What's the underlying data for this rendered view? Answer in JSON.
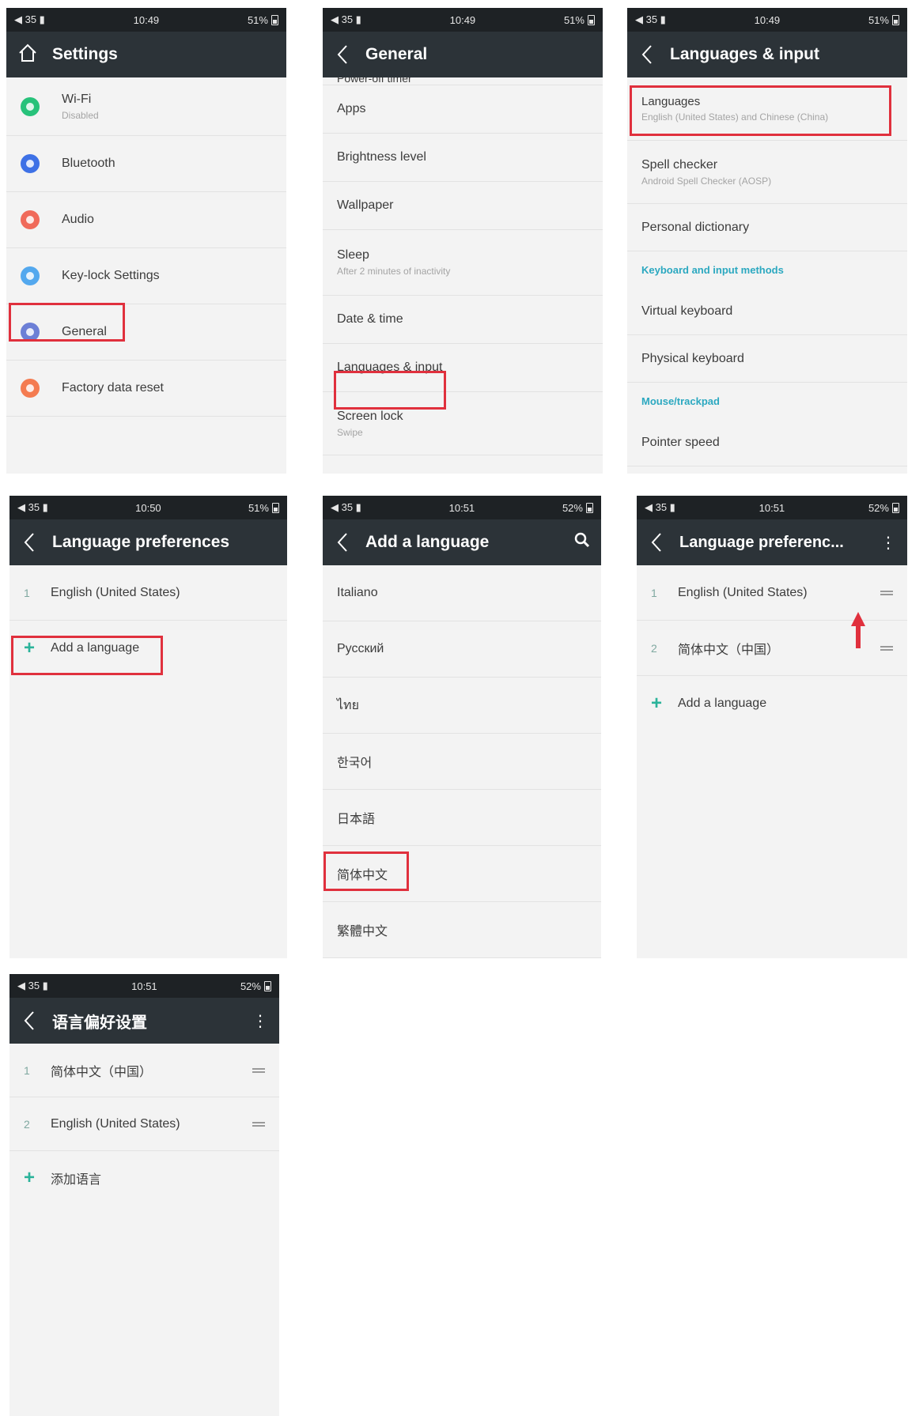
{
  "status": {
    "s1": {
      "left": "◀ 35 ▮",
      "time": "10:49",
      "battery": "51%"
    },
    "s2": {
      "left": "◀ 35 ▮",
      "time": "10:49",
      "battery": "51%"
    },
    "s3": {
      "left": "◀ 35 ▮",
      "time": "10:49",
      "battery": "51%"
    },
    "s4": {
      "left": "◀ 35 ▮",
      "time": "10:50",
      "battery": "51%"
    },
    "s5": {
      "left": "◀ 35 ▮",
      "time": "10:51",
      "battery": "52%"
    },
    "s6": {
      "left": "◀ 35 ▮",
      "time": "10:51",
      "battery": "52%"
    },
    "s7": {
      "left": "◀ 35 ▮",
      "time": "10:51",
      "battery": "52%"
    }
  },
  "settings": {
    "title": "Settings",
    "items": [
      {
        "label": "Wi-Fi",
        "sub": "Disabled",
        "color": "#27c27a",
        "icon": "wifi-icon"
      },
      {
        "label": "Bluetooth",
        "color": "#3e71e6",
        "icon": "bluetooth-icon"
      },
      {
        "label": "Audio",
        "color": "#f06a5a",
        "icon": "audio-icon"
      },
      {
        "label": "Key-lock Settings",
        "color": "#53a8ee",
        "icon": "key-lock-icon"
      },
      {
        "label": "General",
        "color": "#6c7fd6",
        "icon": "general-icon"
      },
      {
        "label": "Factory data reset",
        "color": "#f47b50",
        "icon": "factory-reset-icon"
      }
    ]
  },
  "general": {
    "title": "General",
    "cut_item": "Power-off timer",
    "items": [
      {
        "label": "Apps"
      },
      {
        "label": "Brightness level"
      },
      {
        "label": "Wallpaper"
      },
      {
        "label": "Sleep",
        "sub": "After 2 minutes of inactivity"
      },
      {
        "label": "Date & time"
      },
      {
        "label": "Languages & input"
      },
      {
        "label": "Screen lock",
        "sub": "Swipe"
      }
    ]
  },
  "languages_input": {
    "title": "Languages & input",
    "languages": {
      "label": "Languages",
      "sub": "English (United States) and Chinese (China)"
    },
    "spell": {
      "label": "Spell checker",
      "sub": "Android Spell Checker (AOSP)"
    },
    "personal": "Personal dictionary",
    "section_keyboard": "Keyboard and input methods",
    "virtual": "Virtual keyboard",
    "physical": "Physical keyboard",
    "section_mouse": "Mouse/trackpad",
    "pointer": "Pointer speed"
  },
  "lang_pref": {
    "title": "Language preferences",
    "item1_num": "1",
    "item1": "English (United States)",
    "add": "Add a language"
  },
  "add_language": {
    "title": "Add a language",
    "items": [
      "Italiano",
      "Русский",
      "ไทย",
      "한국어",
      "日本語",
      "简体中文",
      "繁體中文"
    ]
  },
  "lang_pref2": {
    "title": "Language preferenc...",
    "item1_num": "1",
    "item1": "English (United States)",
    "item2_num": "2",
    "item2": "简体中文（中国）",
    "add": "Add a language"
  },
  "lang_pref_cn": {
    "title": "语言偏好设置",
    "item1_num": "1",
    "item1": "简体中文（中国）",
    "item2_num": "2",
    "item2": "English (United States)",
    "add": "添加语言"
  },
  "glyphs": {
    "plus": "+",
    "menu": "⋮",
    "search": "🔍"
  },
  "accent_colors": {
    "highlight": "#e0303d",
    "appbar": "#2c3338",
    "statusbar": "#1e2225",
    "teal": "#2bb39a"
  }
}
